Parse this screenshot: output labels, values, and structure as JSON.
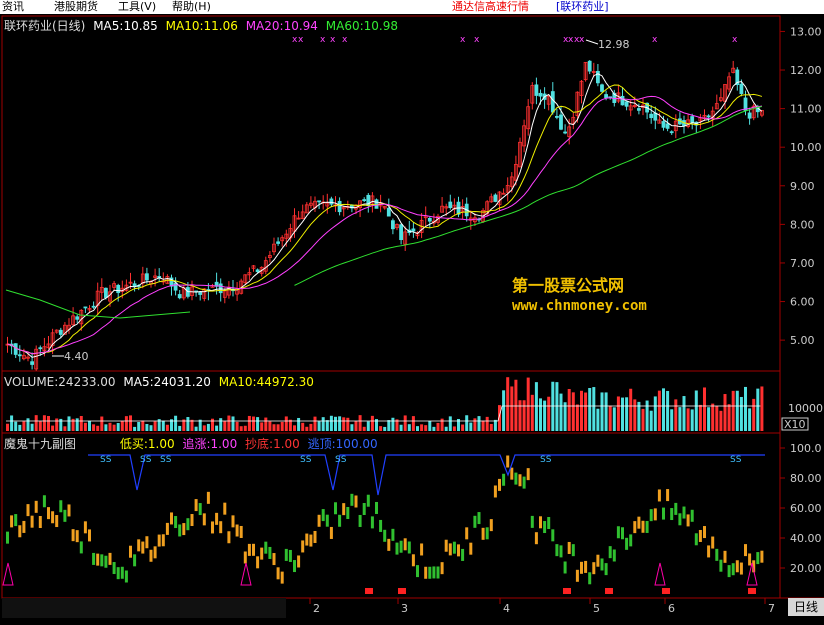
{
  "menu": [
    "资讯",
    "港股期货",
    "工具(V)",
    "帮助(H)"
  ],
  "window_title": "通达信高速行情",
  "stock_tag": "[联环药业]",
  "main_legend": {
    "name": "联环药业(日线)",
    "ma5": "MA5:10.85",
    "ma10": "MA10:11.06",
    "ma20": "MA20:10.94",
    "ma60": "MA60:10.98"
  },
  "price_axis": [
    "13.00",
    "12.00",
    "11.00",
    "10.00",
    "9.00",
    "8.00",
    "7.00",
    "6.00",
    "5.00"
  ],
  "price_annotations": {
    "high": "12.98",
    "low": "4.40"
  },
  "volume_legend": {
    "volume": "VOLUME:24233.00",
    "ma5": "MA5:24031.20",
    "ma10": "MA10:44972.30"
  },
  "volume_axis": {
    "tick": "10000",
    "unit": "X10"
  },
  "indicator_legend": {
    "name": "魔鬼十九副图",
    "buy": "低买:1.00",
    "chase": "追涨:1.00",
    "bottom": "抄底:1.00",
    "escape": "逃顶:100.00"
  },
  "indicator_axis": [
    "100.0",
    "80.00",
    "60.00",
    "40.00",
    "20.00"
  ],
  "signal_text": "SS",
  "time_axis": [
    "2",
    "3",
    "4",
    "5",
    "6",
    "7"
  ],
  "period_button": "日线",
  "watermark": {
    "line1": "第一股票公式网",
    "line2": "www.chnmoney.com"
  },
  "colors": {
    "up": "#ff3030",
    "down": "#50e0e0",
    "ma5": "#ffffff",
    "ma10": "#f0f000",
    "ma20": "#ff40ff",
    "ma60": "#30e030",
    "grid": "#a00000",
    "escape_line": "#2040ff"
  },
  "chart_data": {
    "type": "candlestick",
    "ylim": [
      4.2,
      13.4
    ],
    "high": 12.98,
    "low": 4.4
  }
}
